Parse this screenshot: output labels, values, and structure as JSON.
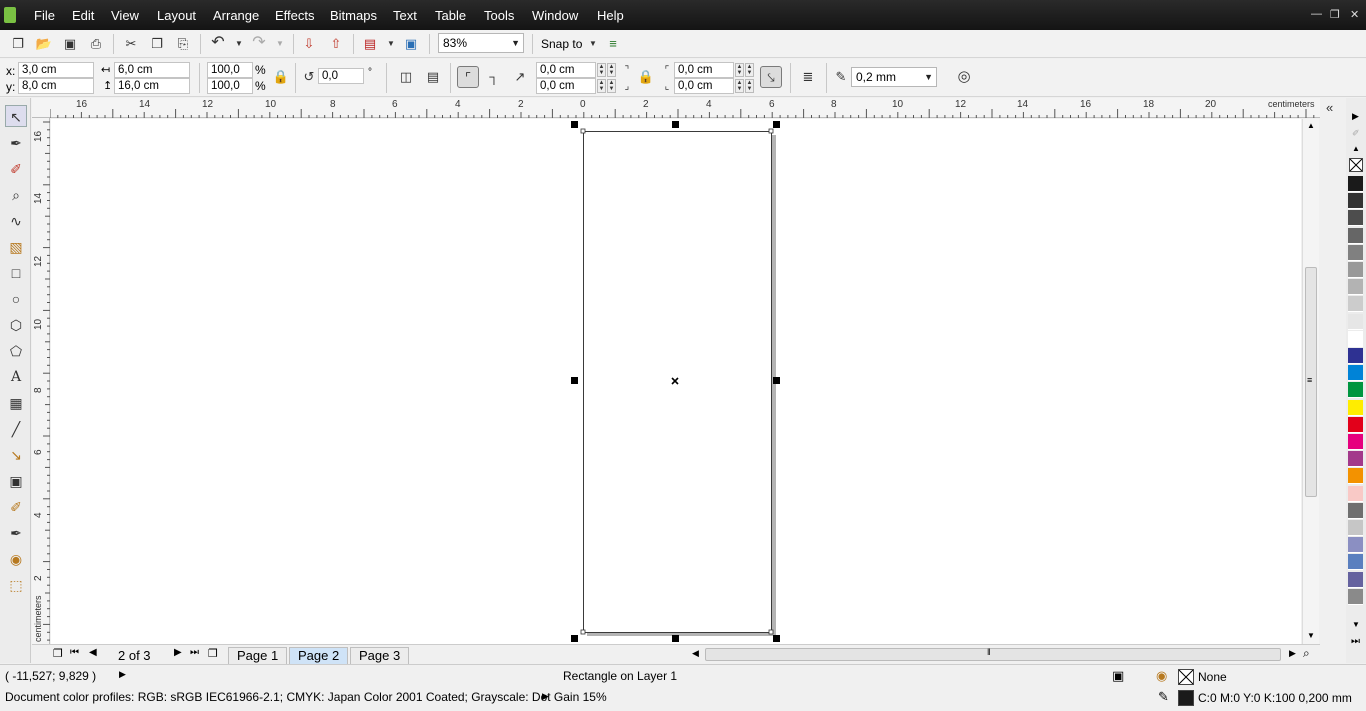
{
  "menubar": {
    "items": [
      "File",
      "Edit",
      "View",
      "Layout",
      "Arrange",
      "Effects",
      "Bitmaps",
      "Text",
      "Table",
      "Tools",
      "Window",
      "Help"
    ]
  },
  "standard_toolbar": {
    "zoom": "83%",
    "snap_to": "Snap to"
  },
  "property_bar": {
    "x_label": "x:",
    "x_value": "3,0 cm",
    "y_label": "y:",
    "y_value": "8,0 cm",
    "width_value": "6,0 cm",
    "height_value": "16,0 cm",
    "scale_w": "100,0",
    "scale_h": "100,0",
    "pct": "%",
    "rotation": "0,0",
    "deg": "°",
    "corner_tl": "0,0 cm",
    "corner_bl": "0,0 cm",
    "corner_tr": "0,0 cm",
    "corner_br": "0,0 cm",
    "outline_width": "0,2 mm"
  },
  "ruler": {
    "unit": "centimeters",
    "h_labels": [
      "16",
      "14",
      "12",
      "10",
      "8",
      "6",
      "4",
      "2",
      "0",
      "2",
      "4",
      "6",
      "8",
      "10",
      "12",
      "14",
      "16",
      "18",
      "20"
    ],
    "v_labels": [
      "16",
      "14",
      "12",
      "10",
      "8",
      "6",
      "4",
      "2"
    ]
  },
  "pages": {
    "indicator": "2 of 3",
    "tabs": [
      "Page 1",
      "Page 2",
      "Page 3"
    ],
    "active": "Page 2"
  },
  "palette": {
    "colors": [
      "#1a1a1a",
      "#333333",
      "#4d4d4d",
      "#666666",
      "#808080",
      "#999999",
      "#b3b3b3",
      "#cccccc",
      "#e6e6e6",
      "#ffffff",
      "#2e3192",
      "#0083d7",
      "#009640",
      "#ffed00",
      "#e2001a",
      "#e6007e",
      "#a3398b",
      "#f39200",
      "#f9c9c6",
      "#6f6f6f",
      "#c6c6c6",
      "#8b8fc2",
      "#5a7fbf",
      "#65629f",
      "#8a8a8a"
    ]
  },
  "status": {
    "coords": "( -11,527; 9,829 )",
    "object_info": "Rectangle on Layer 1",
    "fill_label": "None",
    "outline_info": "C:0 M:0 Y:0 K:100  0,200 mm",
    "color_profiles": "Document color profiles: RGB: sRGB IEC61966-2.1; CMYK: Japan Color 2001 Coated; Grayscale: Dot Gain 15%"
  }
}
